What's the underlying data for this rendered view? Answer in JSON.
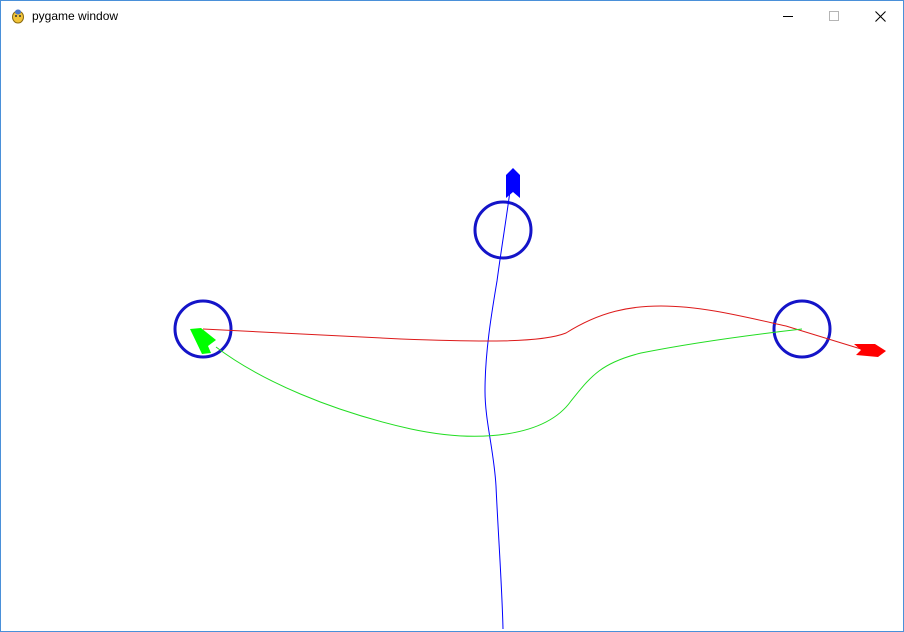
{
  "window": {
    "title": "pygame window",
    "icon": "pygame-snake-icon",
    "controls": [
      "minimize-icon",
      "maximize-icon",
      "close-icon"
    ]
  },
  "scene": {
    "background": "#ffffff",
    "waypoint_color": "#1414c8",
    "agents": [
      {
        "name": "blue-agent",
        "color": "#0000ff"
      },
      {
        "name": "red-agent",
        "color": "#ff0000"
      },
      {
        "name": "green-agent",
        "color": "#00ff00"
      }
    ]
  }
}
